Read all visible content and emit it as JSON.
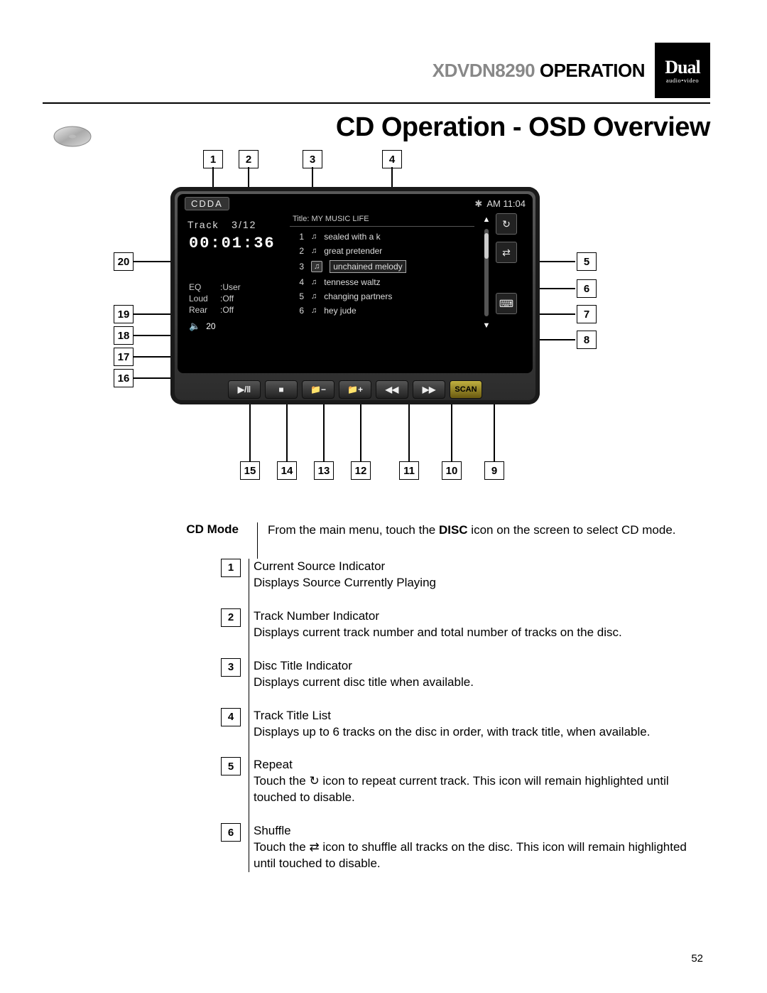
{
  "header": {
    "model": "XDVDN8290",
    "operation": "OPERATION"
  },
  "brand": {
    "name": "Dual",
    "tagline": "audio•video"
  },
  "page_title": "CD Operation - OSD Overview",
  "osd": {
    "mode": "CDDA",
    "clock": "AM 11:04",
    "track_counter_label": "Track",
    "track_counter": "3/12",
    "elapsed": "00:01:36",
    "eq_label": "EQ",
    "eq_value": ":User",
    "loud_label": "Loud",
    "loud_value": ":Off",
    "rear_label": "Rear",
    "rear_value": ":Off",
    "volume": "20",
    "disc_title_label": "Title:",
    "disc_title": "MY  MUSIC LIFE",
    "tracks": [
      {
        "n": "1",
        "name": "sealed with a k"
      },
      {
        "n": "2",
        "name": "great pretender"
      },
      {
        "n": "3",
        "name": "unchained melody"
      },
      {
        "n": "4",
        "name": "tennesse waltz"
      },
      {
        "n": "5",
        "name": "changing partners"
      },
      {
        "n": "6",
        "name": "hey jude"
      }
    ],
    "scan": "SCAN",
    "folder_minus": "−",
    "folder_plus": "+"
  },
  "callouts": {
    "c1": "1",
    "c2": "2",
    "c3": "3",
    "c4": "4",
    "c5": "5",
    "c6": "6",
    "c7": "7",
    "c8": "8",
    "c9": "9",
    "c10": "10",
    "c11": "11",
    "c12": "12",
    "c13": "13",
    "c14": "14",
    "c15": "15",
    "c16": "16",
    "c17": "17",
    "c18": "18",
    "c19": "19",
    "c20": "20"
  },
  "desc": {
    "mode_label": "CD Mode",
    "mode_text_a": "From the main menu, touch the ",
    "mode_text_b": "DISC",
    "mode_text_c": " icon on the screen to select CD mode.",
    "items": [
      {
        "n": "1",
        "title": "Current Source Indicator",
        "sub": "Displays Source Currently Playing"
      },
      {
        "n": "2",
        "title": "Track Number Indicator",
        "sub": "Displays current track number and total number of tracks on the disc."
      },
      {
        "n": "3",
        "title": "Disc Title Indicator",
        "sub": "Displays current disc title when available."
      },
      {
        "n": "4",
        "title": "Track Title List",
        "sub": "Displays up to 6 tracks on the disc in order, with track title, when available."
      },
      {
        "n": "5",
        "title": "Repeat",
        "sub": "Touch the ↻ icon to repeat current track. This icon will remain highlighted until touched to disable."
      },
      {
        "n": "6",
        "title": "Shuffle",
        "sub": "Touch the ⇄ icon to shuffle all tracks on the disc. This icon will remain highlighted until touched to disable."
      }
    ]
  },
  "page_number": "52"
}
